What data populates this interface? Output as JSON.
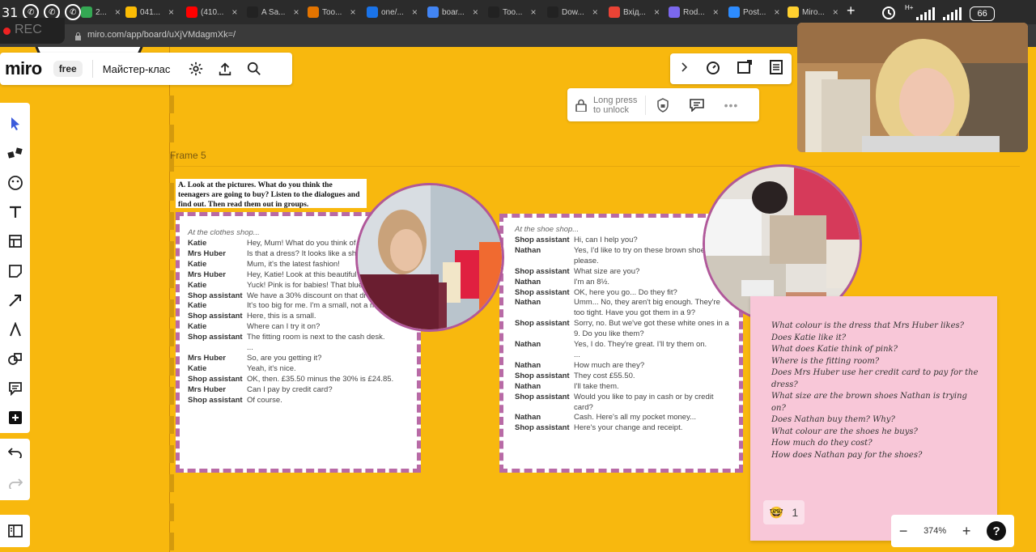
{
  "browser": {
    "time": "31",
    "rec_label": "REC",
    "url": "miro.com/app/board/uXjVMdagmXk=/",
    "battery": "66",
    "network": "H+",
    "tabs": [
      {
        "label": "2...",
        "icon": "document-icon",
        "color": "#34a853"
      },
      {
        "label": "041...",
        "icon": "drive-icon",
        "color": "#fbbc04"
      },
      {
        "label": "(410...",
        "icon": "youtube-icon",
        "color": "#ff0000"
      },
      {
        "label": "A Sa...",
        "icon": "isl-icon",
        "color": "#222222"
      },
      {
        "label": "Too...",
        "icon": "tab-icon",
        "color": "#e37400"
      },
      {
        "label": "one/...",
        "icon": "tab-icon",
        "color": "#1a73e8"
      },
      {
        "label": "boar...",
        "icon": "google-icon",
        "color": "#4285f4"
      },
      {
        "label": "Too...",
        "icon": "isl-icon",
        "color": "#222222"
      },
      {
        "label": "Dow...",
        "icon": "isl-icon",
        "color": "#222222"
      },
      {
        "label": "Вхід...",
        "icon": "gmail-icon",
        "color": "#ea4335"
      },
      {
        "label": "Rod...",
        "icon": "tab-icon",
        "color": "#7b68ee"
      },
      {
        "label": "Post...",
        "icon": "zoom-icon",
        "color": "#2d8cff"
      },
      {
        "label": "Miro...",
        "icon": "miro-icon",
        "color": "#ffd02f"
      }
    ]
  },
  "toolbar": {
    "logo": "miro",
    "plan": "free",
    "board_name": "Майстер-клас"
  },
  "lock": {
    "label_line1": "Long press",
    "label_line2": "to unlock"
  },
  "frame": {
    "label": "Frame 5"
  },
  "instruction": "A. Look at the pictures. What do you think the teenagers are going to buy? Listen to the dialogues and find out. Then read them out in groups.",
  "dialog1": {
    "setting": "At the clothes shop...",
    "lines": [
      {
        "speaker": "Katie",
        "text": "Hey, Mum! What do you think of this dress?"
      },
      {
        "speaker": "Mrs Huber",
        "text": "Is that a dress? It looks like a shirt!"
      },
      {
        "speaker": "Katie",
        "text": "Mum, it's the latest fashion!"
      },
      {
        "speaker": "Mrs Huber",
        "text": "Hey, Katie! Look at this beautiful pink dress!"
      },
      {
        "speaker": "Katie",
        "text": "Yuck! Pink is for babies! That blue one isn't bad."
      },
      {
        "speaker": "Shop assistant",
        "text": "We have a 30% discount on that dress."
      },
      {
        "speaker": "Katie",
        "text": "It's too big for me. I'm a small, not a medium."
      },
      {
        "speaker": "Shop assistant",
        "text": "Here, this is a small."
      },
      {
        "speaker": "Katie",
        "text": "Where can I try it on?"
      },
      {
        "speaker": "Shop assistant",
        "text": "The fitting room is next to the cash desk."
      },
      {
        "speaker": "",
        "text": "..."
      },
      {
        "speaker": "Mrs Huber",
        "text": "So, are you getting it?"
      },
      {
        "speaker": "Katie",
        "text": "Yeah, it's nice."
      },
      {
        "speaker": "Shop assistant",
        "text": "OK, then. £35.50 minus the 30% is £24.85."
      },
      {
        "speaker": "Mrs Huber",
        "text": "Can I pay by credit card?"
      },
      {
        "speaker": "Shop assistant",
        "text": "Of course."
      }
    ]
  },
  "dialog2": {
    "setting": "At the shoe shop...",
    "lines": [
      {
        "speaker": "Shop assistant",
        "text": "Hi, can I help you?"
      },
      {
        "speaker": "Nathan",
        "text": "Yes, I'd like to try on these brown shoes, please."
      },
      {
        "speaker": "Shop assistant",
        "text": "What size are you?"
      },
      {
        "speaker": "Nathan",
        "text": "I'm an 8½."
      },
      {
        "speaker": "Shop assistant",
        "text": "OK, here you go... Do they fit?"
      },
      {
        "speaker": "Nathan",
        "text": "Umm... No, they aren't big enough. They're too tight. Have you got them in a 9?"
      },
      {
        "speaker": "Shop assistant",
        "text": "Sorry, no. But we've got these white ones in a 9. Do you like them?"
      },
      {
        "speaker": "Nathan",
        "text": "Yes, I do. They're great. I'll try them on."
      },
      {
        "speaker": "",
        "text": "..."
      },
      {
        "speaker": "Nathan",
        "text": "How much are they?"
      },
      {
        "speaker": "Shop assistant",
        "text": "They cost £55.50."
      },
      {
        "speaker": "Nathan",
        "text": "I'll take them."
      },
      {
        "speaker": "Shop assistant",
        "text": "Would you like to pay in cash or by credit card?"
      },
      {
        "speaker": "Nathan",
        "text": "Cash. Here's all my pocket money..."
      },
      {
        "speaker": "Shop assistant",
        "text": "Here's your change and receipt."
      }
    ]
  },
  "sticky": {
    "questions": [
      "What colour is the dress that Mrs Huber likes?",
      "Does Katie like it?",
      "What does Katie think of pink?",
      "Where is the fitting room?",
      "Does Mrs Huber use her credit card to pay for the",
      "dress?",
      "What size are the brown shoes Nathan is trying",
      "on?",
      "Does Nathan buy them?  Why?",
      "What colour are the shoes he buys?",
      "How much do they cost?",
      "How does Nathan pay for the shoes?"
    ],
    "reaction_emoji": "🤓",
    "reaction_count": "1"
  },
  "zoom": {
    "level": "374%",
    "help": "?"
  },
  "colors": {
    "board": "#f8b80e",
    "dialog_border": "#b86aa6",
    "sticky": "#f8c7d8"
  }
}
